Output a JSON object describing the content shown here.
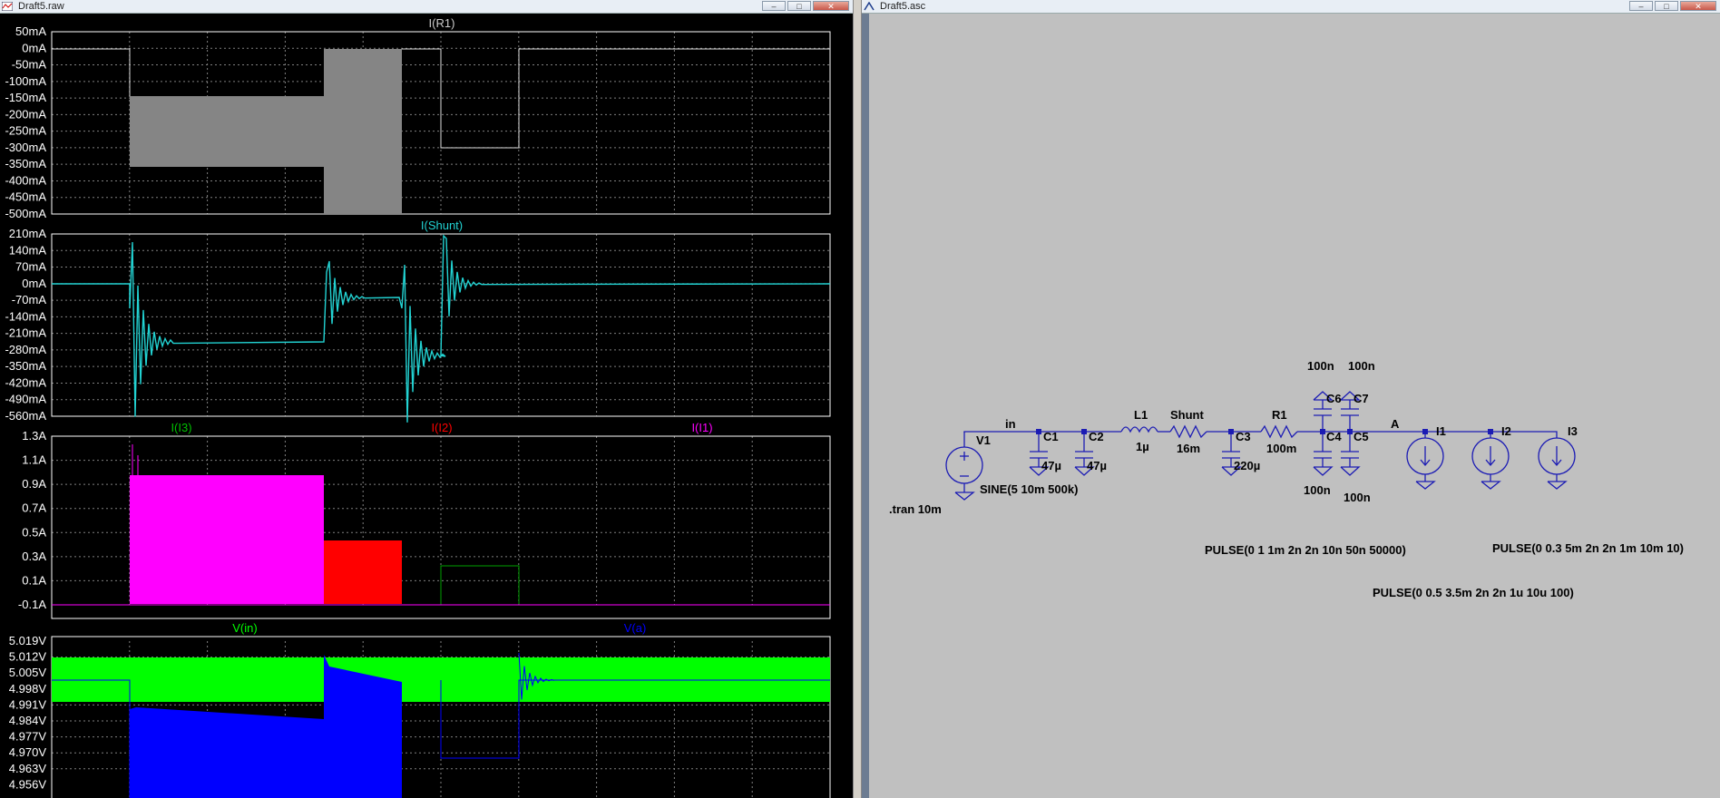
{
  "wave_window": {
    "title": "Draft5.raw",
    "buttons": {
      "minimize": "–",
      "maximize": "□",
      "close": "✕"
    },
    "panes": [
      {
        "traces": [
          {
            "label": "I(R1)",
            "color": "#cccccc"
          }
        ],
        "y_ticks": [
          "50mA",
          "0mA",
          "-50mA",
          "-100mA",
          "-150mA",
          "-200mA",
          "-250mA",
          "-300mA",
          "-350mA",
          "-400mA",
          "-450mA",
          "-500mA"
        ]
      },
      {
        "traces": [
          {
            "label": "I(Shunt)",
            "color": "#22d3d3"
          }
        ],
        "y_ticks": [
          "210mA",
          "140mA",
          "70mA",
          "0mA",
          "-70mA",
          "-140mA",
          "-210mA",
          "-280mA",
          "-350mA",
          "-420mA",
          "-490mA",
          "-560mA"
        ]
      },
      {
        "traces": [
          {
            "label": "I(I3)",
            "color": "#00c000"
          },
          {
            "label": "I(I2)",
            "color": "#ff0000"
          },
          {
            "label": "I(I1)",
            "color": "#ff00ff"
          }
        ],
        "y_ticks": [
          "1.3A",
          "1.1A",
          "0.9A",
          "0.7A",
          "0.5A",
          "0.3A",
          "0.1A",
          "-0.1A"
        ]
      },
      {
        "traces": [
          {
            "label": "V(in)",
            "color": "#00ff00"
          },
          {
            "label": "V(a)",
            "color": "#0000ff"
          }
        ],
        "y_ticks": [
          "5.019V",
          "5.012V",
          "5.005V",
          "4.998V",
          "4.991V",
          "4.984V",
          "4.977V",
          "4.970V",
          "4.963V",
          "4.956V"
        ]
      }
    ]
  },
  "schematic_window": {
    "title": "Draft5.asc",
    "buttons": {
      "minimize": "–",
      "maximize": "□",
      "close": "✕"
    },
    "labels": {
      "V1": "V1",
      "in": "in",
      "C1": "C1",
      "C1v": "47µ",
      "C2": "C2",
      "C2v": "47µ",
      "L1": "L1",
      "L1v": "1µ",
      "Shunt": "Shunt",
      "Shuntv": "16m",
      "C3": "C3",
      "C3v": "220µ",
      "R1": "R1",
      "R1v": "100m",
      "C6": "C6",
      "C7": "C7",
      "C6v": "100n",
      "C7v": "100n",
      "C4": "C4",
      "C5": "C5",
      "C4v": "100n",
      "C5v": "100n",
      "A": "A",
      "I1": "I1",
      "I2": "I2",
      "I3": "I3",
      "V1src": "SINE(5 10m 500k)",
      "tran": ".tran 10m",
      "I1src": "PULSE(0 1 1m 2n 2n 10n 50n 50000)",
      "I2src": "PULSE(0 0.5 3.5m 2n 2n 1u 10u 100)",
      "I3src": "PULSE(0 0.3 5m 2n 2n 1m 10m 10)"
    }
  }
}
